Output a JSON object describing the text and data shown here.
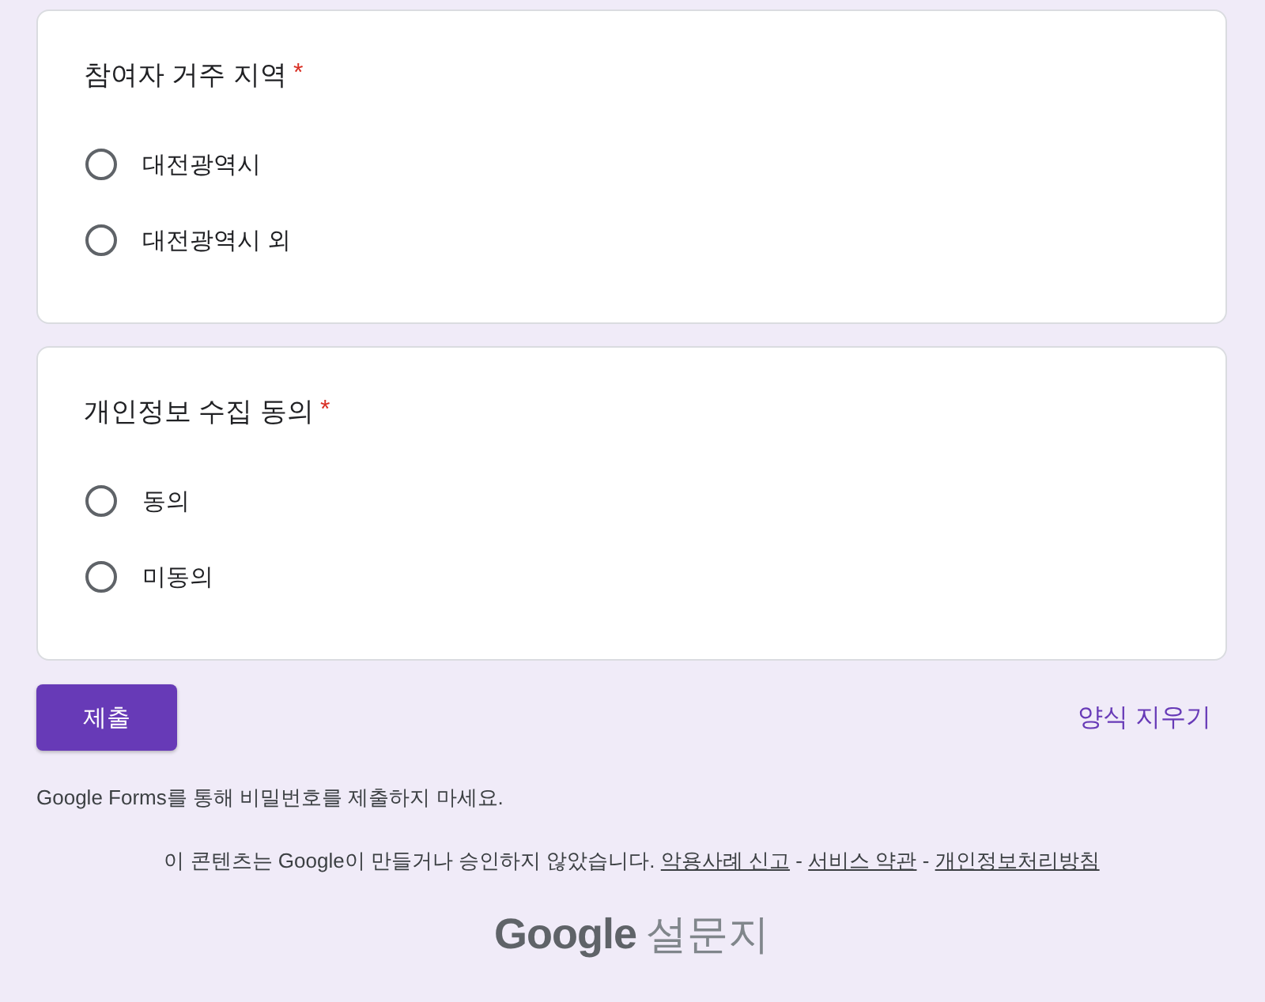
{
  "questions": [
    {
      "title": "참여자 거주 지역",
      "required_mark": "*",
      "options": [
        {
          "label": "대전광역시",
          "selected": false
        },
        {
          "label": "대전광역시 외",
          "selected": false
        }
      ]
    },
    {
      "title": "개인정보 수집 동의",
      "required_mark": "*",
      "options": [
        {
          "label": "동의",
          "selected": false
        },
        {
          "label": "미동의",
          "selected": false
        }
      ]
    }
  ],
  "actions": {
    "submit": "제출",
    "clear": "양식 지우기"
  },
  "footer": {
    "notice": "Google Forms를 통해 비밀번호를 제출하지 마세요.",
    "disclaimer": "이 콘텐츠는 Google이 만들거나 승인하지 않았습니다.",
    "links": [
      {
        "label": "악용사례 신고"
      },
      {
        "label": "서비스 약관"
      },
      {
        "label": "개인정보처리방침"
      }
    ],
    "separators": [
      "-",
      "-"
    ]
  },
  "logo": {
    "brand": "Google",
    "product": "설문지"
  }
}
